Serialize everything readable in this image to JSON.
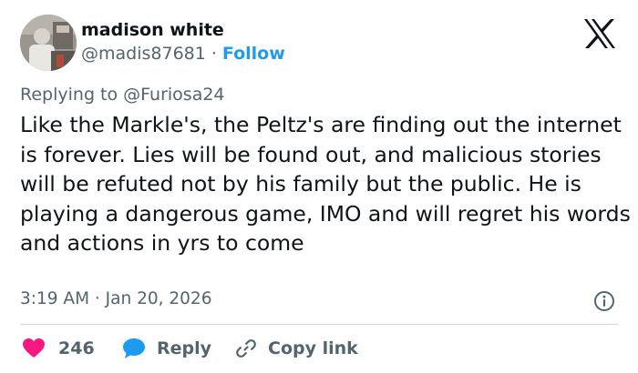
{
  "author": {
    "name": "madison white",
    "handle": "@madis87681",
    "separator": "·",
    "follow_label": "Follow"
  },
  "reply_context": {
    "label": "Replying to @Furiosa24"
  },
  "tweet": {
    "text": "Like the Markle's, the Peltz's are finding out the internet is forever. Lies will be found out, and malicious stories will be refuted not by his family but the public. He is playing a dangerous game, IMO and will regret his words and actions in yrs to come",
    "timestamp": "3:19 AM · Jan 20, 2026"
  },
  "actions": {
    "like_count": "246",
    "reply_label": "Reply",
    "copy_label": "Copy link"
  },
  "icons": {
    "logo": "x-logo-icon",
    "info": "info-icon",
    "like": "heart-icon",
    "reply": "speech-bubble-icon",
    "copy": "link-icon"
  },
  "colors": {
    "accent": "#1d9bf0",
    "like": "#f91880",
    "text": "#0f1419",
    "secondary": "#536471",
    "divider": "#cfd9de"
  }
}
